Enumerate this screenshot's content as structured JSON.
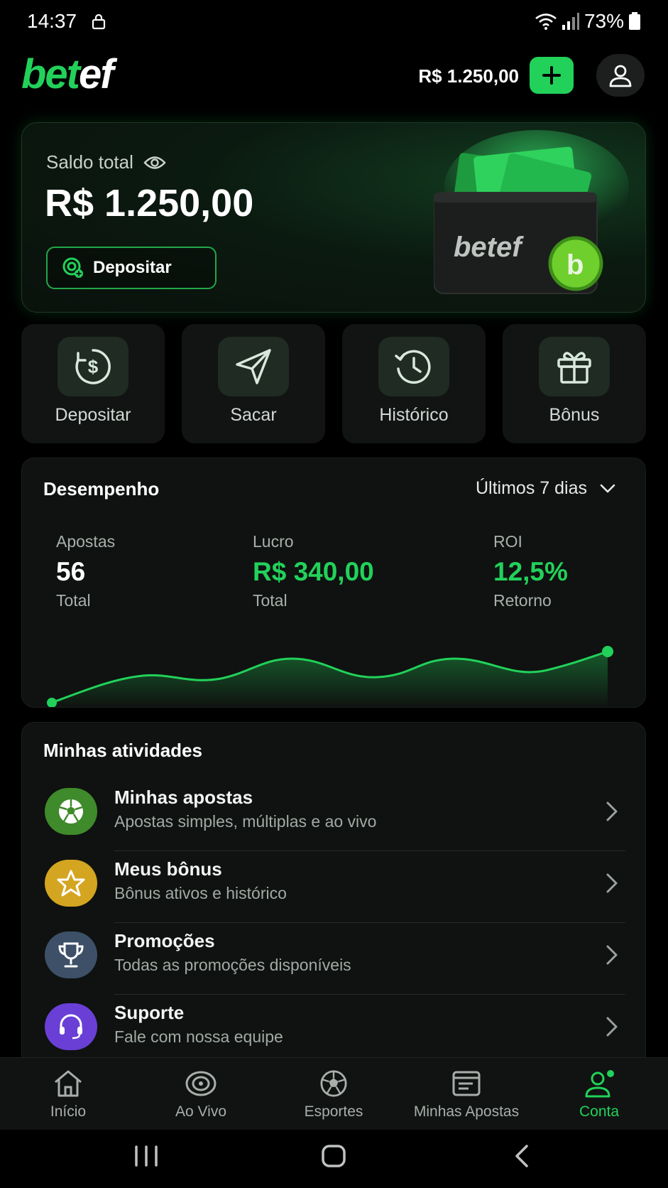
{
  "status_bar": {
    "time": "14:37",
    "battery": "73%"
  },
  "header": {
    "logo_green": "bet",
    "logo_white": "ef",
    "balance": "R$ 1.250,00"
  },
  "balance_card": {
    "label": "Saldo total",
    "value": "R$ 1.250,00",
    "deposit_label": "Depositar",
    "wallet_logo": "betef",
    "coin_letter": "b"
  },
  "quick_actions": [
    {
      "label": "Depositar",
      "icon": "dollar-circle-icon"
    },
    {
      "label": "Sacar",
      "icon": "send-icon"
    },
    {
      "label": "Histórico",
      "icon": "history-icon"
    },
    {
      "label": "Bônus",
      "icon": "gift-icon"
    }
  ],
  "performance": {
    "title": "Desempenho",
    "period": "Últimos 7 dias",
    "metrics": [
      {
        "label": "Apostas",
        "value": "56",
        "sub": "Total"
      },
      {
        "label": "Lucro",
        "value": "R$ 340,00",
        "sub": "Total"
      },
      {
        "label": "ROI",
        "value": "12,5%",
        "sub": "Retorno"
      }
    ]
  },
  "activities": {
    "title": "Minhas atividades",
    "items": [
      {
        "title": "Minhas apostas",
        "subtitle": "Apostas simples, múltiplas e ao vivo",
        "icon": "soccer-ball-icon",
        "color": "#3f8a2a"
      },
      {
        "title": "Meus bônus",
        "subtitle": "Bônus ativos e histórico",
        "icon": "star-icon",
        "color": "#d4a520"
      },
      {
        "title": "Promoções",
        "subtitle": "Todas as promoções disponíveis",
        "icon": "trophy-icon",
        "color": "#3d5068"
      },
      {
        "title": "Suporte",
        "subtitle": "Fale com nossa equipe",
        "icon": "headset-icon",
        "color": "#6a3fd6"
      }
    ]
  },
  "bottom_nav": [
    {
      "label": "Início",
      "icon": "home-icon"
    },
    {
      "label": "Ao Vivo",
      "icon": "live-icon"
    },
    {
      "label": "Esportes",
      "icon": "soccer-ball-icon"
    },
    {
      "label": "Minhas Apostas",
      "icon": "ticket-icon"
    },
    {
      "label": "Conta",
      "icon": "user-icon",
      "active": true
    }
  ],
  "colors": {
    "accent": "#22d15a",
    "background": "#000000",
    "card": "#0f1210"
  }
}
